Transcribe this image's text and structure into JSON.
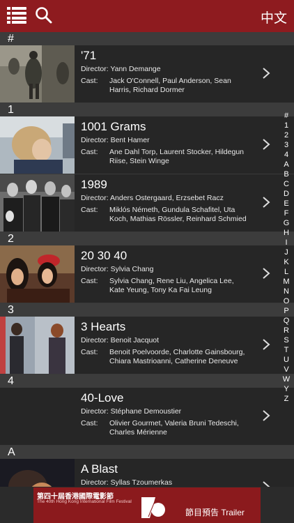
{
  "topbar": {
    "lang_label": "中文"
  },
  "sections": [
    {
      "letter": "#",
      "films": [
        {
          "title": "'71",
          "director_label": "Director: Yann Demange",
          "cast_label": "Cast:",
          "cast": "Jack O'Connell, Paul Anderson, Sean Harris, Richard Dormer"
        }
      ]
    },
    {
      "letter": "1",
      "films": [
        {
          "title": "1001 Grams",
          "director_label": "Director: Bent Hamer",
          "cast_label": "Cast:",
          "cast": "Ane Dahl Torp, Laurent Stocker, Hildegun Riise, Stein Winge"
        },
        {
          "title": "1989",
          "director_label": "Director: Anders Ostergaard, Erzsebet Racz",
          "cast_label": "Cast:",
          "cast": "Miklós Németh, Gundula Schafitel, Uta Koch, Mathias Rössler, Reinhard Schmied"
        }
      ]
    },
    {
      "letter": "2",
      "films": [
        {
          "title": "20 30 40",
          "director_label": "Director: Sylvia Chang",
          "cast_label": "Cast:",
          "cast": "Sylvia Chang, Rene Liu, Angelica Lee, Kate Yeung, Tony Ka Fai Leung"
        }
      ]
    },
    {
      "letter": "3",
      "films": [
        {
          "title": "3 Hearts",
          "director_label": "Director: Benoit Jacquot",
          "cast_label": "Cast:",
          "cast": "Benoit Poelvoorde, Charlotte Gainsbourg, Chiara Mastrioanni, Catherine Deneuve"
        }
      ]
    },
    {
      "letter": "4",
      "films": [
        {
          "title": "40-Love",
          "director_label": "Director: Stéphane Demoustier",
          "cast_label": "Cast:",
          "cast": "Olivier Gourmet, Valeria Bruni Tedeschi, Charles Mérienne"
        }
      ]
    },
    {
      "letter": "A",
      "films": [
        {
          "title": "A Blast",
          "director_label": "Director: Syllas Tzoumerkas",
          "cast_label": "",
          "cast": ""
        }
      ]
    }
  ],
  "index": [
    "#",
    "1",
    "2",
    "3",
    "4",
    "A",
    "B",
    "C",
    "D",
    "E",
    "F",
    "G",
    "H",
    "I",
    "J",
    "K",
    "L",
    "M",
    "N",
    "O",
    "P",
    "Q",
    "R",
    "S",
    "T",
    "U",
    "V",
    "W",
    "Y",
    "Z"
  ],
  "banner": {
    "chinese_title": "第四十屆香港國際電影節",
    "english_title": "The 40th Hong Kong International Film Festival",
    "label": "節目預告 Trailer"
  }
}
